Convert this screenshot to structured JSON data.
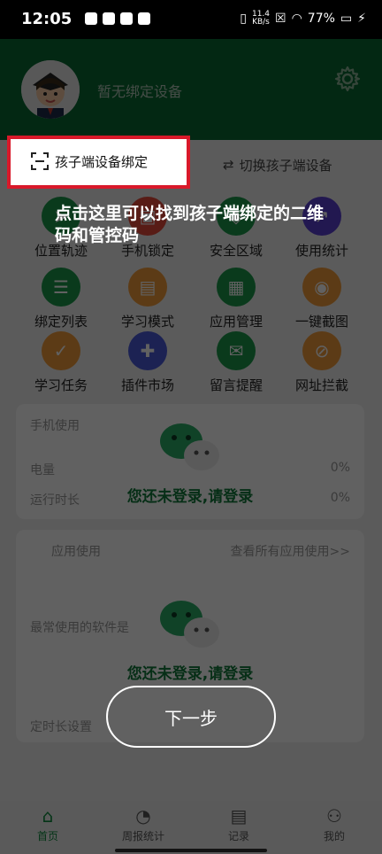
{
  "status_bar": {
    "time": "12:05",
    "network_speed_value": "11.4",
    "network_speed_unit": "KB/s",
    "battery": "77%"
  },
  "header": {
    "device_status": "暂无绑定设备"
  },
  "binding": {
    "bind_child_label": "孩子端设备绑定",
    "switch_child_label": "切换孩子端设备"
  },
  "guide": {
    "tip_text": "点击这里可以找到孩子端绑定的二维码和管控码",
    "next_label": "下一步"
  },
  "features": [
    {
      "label": "位置轨迹",
      "color": "#1b9a4b",
      "icon": "location-icon"
    },
    {
      "label": "手机锁定",
      "color": "#e64a3c",
      "icon": "lock-icon"
    },
    {
      "label": "安全区域",
      "color": "#1b9a4b",
      "icon": "shield-icon"
    },
    {
      "label": "使用统计",
      "color": "#5b3fd1",
      "icon": "chart-icon"
    },
    {
      "label": "绑定列表",
      "color": "#1b9a4b",
      "icon": "list-icon"
    },
    {
      "label": "学习模式",
      "color": "#f29b3b",
      "icon": "book-icon"
    },
    {
      "label": "应用管理",
      "color": "#1b9a4b",
      "icon": "apps-icon"
    },
    {
      "label": "一键截图",
      "color": "#f29b3b",
      "icon": "camera-icon"
    },
    {
      "label": "学习任务",
      "color": "#f29b3b",
      "icon": "task-icon"
    },
    {
      "label": "插件市场",
      "color": "#4a5ad9",
      "icon": "puzzle-icon"
    },
    {
      "label": "留言提醒",
      "color": "#1b9a4b",
      "icon": "message-icon"
    },
    {
      "label": "网址拦截",
      "color": "#f29b3b",
      "icon": "url-block-icon"
    }
  ],
  "card_usage": {
    "title": "手机使用",
    "row1_label": "电量",
    "row1_value": "0%",
    "row2_label": "运行时长",
    "row2_value": "0%",
    "login_prompt": "您还未登录,请登录"
  },
  "card_apps": {
    "title": "应用使用",
    "link": "查看所有应用使用>>",
    "subtitle": "最常使用的软件是",
    "login_prompt": "您还未登录,请登录",
    "footer": "定时长设置"
  },
  "bottom_nav": [
    {
      "label": "首页",
      "icon": "home-icon"
    },
    {
      "label": "周报统计",
      "icon": "pie-chart-icon"
    },
    {
      "label": "记录",
      "icon": "document-icon"
    },
    {
      "label": "我的",
      "icon": "user-group-icon"
    }
  ],
  "colors": {
    "primary_green": "#0a6b33",
    "highlight_red": "#d9192a"
  }
}
